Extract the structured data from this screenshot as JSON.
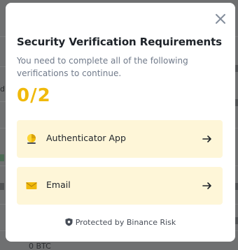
{
  "background": {
    "fragments": [
      "d",
      "0 BTC"
    ]
  },
  "modal": {
    "title": "Security Verification Requirements",
    "subtitle": "You need to complete all of the following verifications to continue.",
    "progress": "0/2",
    "methods": [
      {
        "label": "Authenticator App",
        "icon": "authenticator-icon"
      },
      {
        "label": "Email",
        "icon": "email-icon"
      }
    ],
    "footer": "Protected by Binance Risk"
  },
  "colors": {
    "accent": "#f0b90b",
    "method_bg": "#fef6d8",
    "text_primary": "#1e2329",
    "text_secondary": "#707a8a"
  }
}
